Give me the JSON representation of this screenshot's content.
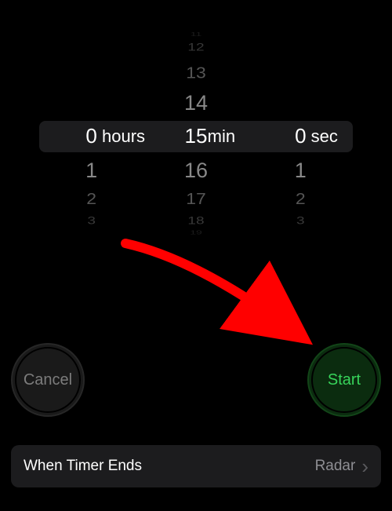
{
  "picker": {
    "hours": {
      "unit_label": "hours",
      "selected": "0",
      "below": [
        "1",
        "2",
        "3"
      ]
    },
    "minutes": {
      "unit_label": "min",
      "above": [
        "11",
        "12",
        "13",
        "14"
      ],
      "selected": "15",
      "below": [
        "16",
        "17",
        "18",
        "19"
      ]
    },
    "seconds": {
      "unit_label": "sec",
      "selected": "0",
      "below": [
        "1",
        "2",
        "3"
      ]
    }
  },
  "buttons": {
    "cancel": "Cancel",
    "start": "Start"
  },
  "timer_ends": {
    "title": "When Timer Ends",
    "value": "Radar"
  },
  "annotation": {
    "arrow_color": "#ff0000"
  }
}
